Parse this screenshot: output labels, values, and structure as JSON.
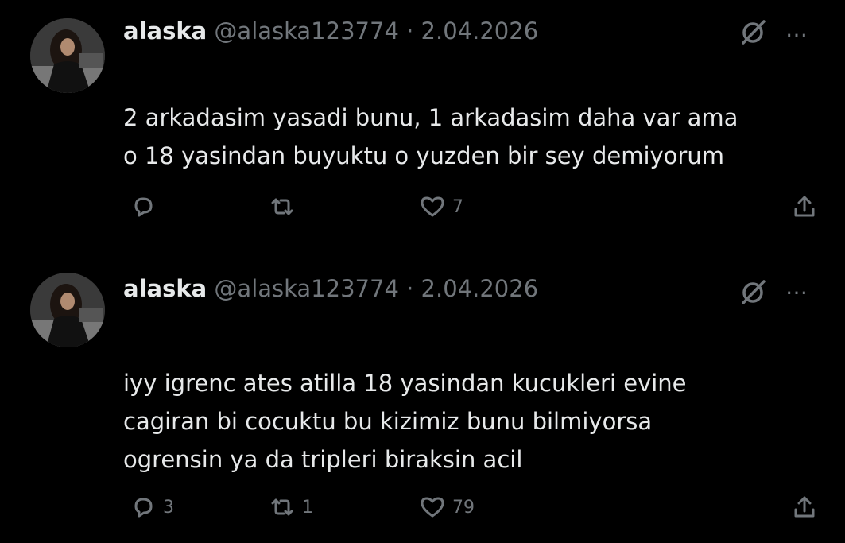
{
  "tweets": [
    {
      "display_name": "alaska",
      "handle": "@alaska123774",
      "separator": "·",
      "date": "2.04.2026",
      "text_lines": [
        "2 arkadasim yasadi bunu, 1 arkadasim daha var ama",
        "o 18 yasindan buyuktu o yuzden bir sey demiyorum"
      ],
      "reply_count": "",
      "retweet_count": "",
      "like_count": "7"
    },
    {
      "display_name": "alaska",
      "handle": "@alaska123774",
      "separator": "·",
      "date": "2.04.2026",
      "text_lines": [
        "iyy igrenc ates atilla 18 yasindan kucukleri evine",
        "cagiran bi cocuktu bu kizimiz bunu bilmiyorsa",
        "ogrensin ya da tripleri biraksin acil"
      ],
      "reply_count": "3",
      "retweet_count": "1",
      "like_count": "79"
    }
  ],
  "icons": {
    "more": "…",
    "grok": "grok-icon",
    "reply": "reply-icon",
    "retweet": "retweet-icon",
    "like": "heart-icon",
    "share": "share-icon"
  },
  "colors": {
    "background": "#000000",
    "text": "#e7e9ea",
    "muted": "#71767b",
    "divider": "#2f3336"
  }
}
